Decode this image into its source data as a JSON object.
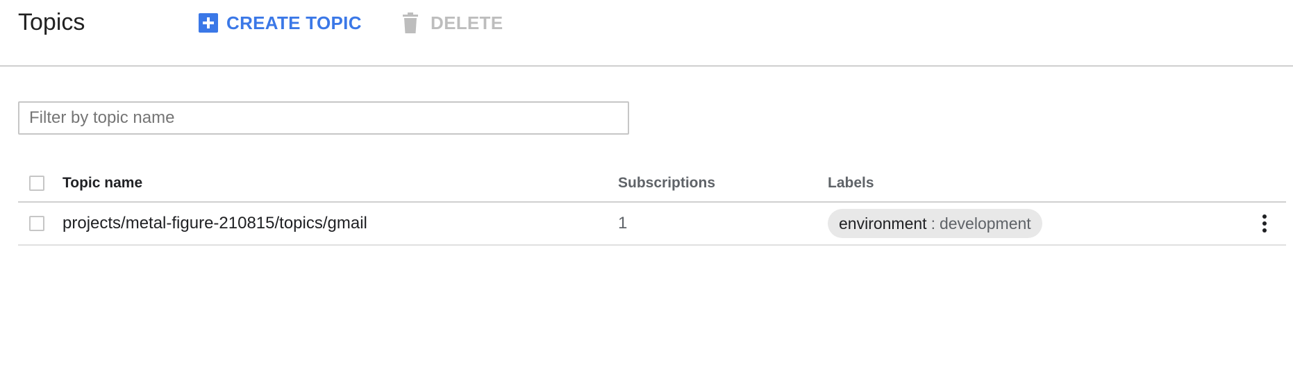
{
  "header": {
    "title": "Topics",
    "create_label": "CREATE TOPIC",
    "delete_label": "DELETE",
    "create_icon": "add-box-icon",
    "delete_icon": "trash-icon"
  },
  "filter": {
    "placeholder": "Filter by topic name",
    "value": ""
  },
  "table": {
    "columns": {
      "name": "Topic name",
      "subscriptions": "Subscriptions",
      "labels": "Labels"
    },
    "rows": [
      {
        "name": "projects/metal-figure-210815/topics/gmail",
        "subscriptions": "1",
        "label_key": "environment",
        "label_separator": ":",
        "label_value": "development"
      }
    ]
  },
  "colors": {
    "accent": "#3b78e7",
    "disabled": "#bdbdbd",
    "chip_background": "#e8e8e8"
  }
}
